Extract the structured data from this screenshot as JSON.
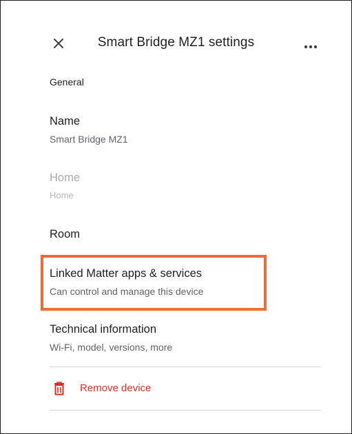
{
  "header": {
    "title": "Smart Bridge MZ1 settings",
    "close_icon": "close-icon",
    "more_icon": "more-horizontal-icon"
  },
  "general": {
    "heading": "General",
    "items": [
      {
        "label": "Name",
        "sub": "Smart Bridge MZ1",
        "enabled": true
      },
      {
        "label": "Home",
        "sub": "Home",
        "enabled": false
      },
      {
        "label": "Room",
        "sub": "",
        "enabled": true
      },
      {
        "label": "Linked Matter apps & services",
        "sub": "Can control and manage this device",
        "enabled": true,
        "highlighted": true
      },
      {
        "label": "Technical information",
        "sub": "Wi-Fi, model, versions, more",
        "enabled": true
      }
    ]
  },
  "remove": {
    "label": "Remove device",
    "icon": "trash-icon"
  },
  "colors": {
    "text_primary": "#202124",
    "text_secondary": "#5f6368",
    "text_disabled": "#a8aaad",
    "danger": "#d93025",
    "highlight": "#ee6a3a",
    "divider": "#d9dadc"
  }
}
